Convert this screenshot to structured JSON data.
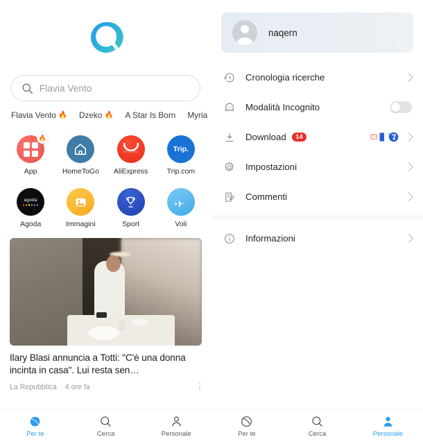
{
  "left": {
    "logo": {
      "name": "qwant-logo",
      "color_start": "#1e9be8",
      "color_end": "#3ec6c9"
    },
    "search": {
      "icon": "search-icon",
      "placeholder": "Flavia Vento"
    },
    "trending": [
      {
        "label": "Flavia Vento",
        "flame": "🔥"
      },
      {
        "label": "Dzeko",
        "flame": "🔥"
      },
      {
        "label": "A Star Is Born",
        "flame": ""
      },
      {
        "label": "Myria",
        "flame": ""
      }
    ],
    "apps": [
      {
        "label": "App",
        "icon": "app-grid-icon",
        "badge": "🔥",
        "color": "#e8554f"
      },
      {
        "label": "HomeToGo",
        "icon": "house-icon",
        "color": "#3f7ca6"
      },
      {
        "label": "AliExpress",
        "icon": "aliexpress-bag-icon",
        "color": "#e8301a",
        "mark": "AliExpress"
      },
      {
        "label": "Trip.com",
        "icon": "trip-logo-icon",
        "color": "#1a73d4",
        "mark": "Trip."
      },
      {
        "label": "Agoda",
        "icon": "agoda-logo-icon",
        "color": "#0d0d0d",
        "mark": "agoda"
      },
      {
        "label": "Immagini",
        "icon": "image-icon",
        "color": "#f5a923"
      },
      {
        "label": "Sport",
        "icon": "trophy-icon",
        "color": "#1f3fa8"
      },
      {
        "label": "Voli",
        "icon": "airplane-icon",
        "color": "#3fa9ea"
      }
    ],
    "news_card": {
      "title": "Ilary Blasi annuncia a Totti: \"C'è una donna incinta in casa\". Lui resta sen…",
      "source": "La Repubblica",
      "time": "4 ore fa",
      "menu_icon": "more-vertical-icon"
    }
  },
  "right": {
    "profile": {
      "name": "naqern",
      "avatar_icon": "avatar-person-icon"
    },
    "menu": [
      {
        "label": "Cronologia ricerche",
        "icon": "clock-history-icon",
        "chevron": true
      },
      {
        "label": "Modalità Incognito",
        "icon": "ghost-incognito-icon",
        "toggle": "off"
      },
      {
        "label": "Download",
        "icon": "download-icon",
        "badge": "14",
        "chevron": true,
        "marks": [
          "chat-bubble-icon",
          "transfer-2-icon"
        ]
      },
      {
        "label": "Impostazioni",
        "icon": "gear-icon",
        "chevron": true
      },
      {
        "label": "Commenti",
        "icon": "comment-edit-icon",
        "chevron": true
      }
    ],
    "menu_secondary": [
      {
        "label": "Informazioni",
        "icon": "info-circle-icon",
        "chevron": true
      }
    ]
  },
  "nav_left": [
    {
      "label": "Per te",
      "icon": "planet-icon",
      "active": true
    },
    {
      "label": "Cerca",
      "icon": "search-icon",
      "active": false
    },
    {
      "label": "Personale",
      "icon": "person-icon",
      "active": false
    }
  ],
  "nav_right": [
    {
      "label": "Per te",
      "icon": "planet-icon",
      "active": false
    },
    {
      "label": "Cerca",
      "icon": "search-icon",
      "active": false
    },
    {
      "label": "Personale",
      "icon": "person-filled-icon",
      "active": true
    }
  ],
  "accent": "#2b9cf0",
  "badge_color": "#e8302a"
}
